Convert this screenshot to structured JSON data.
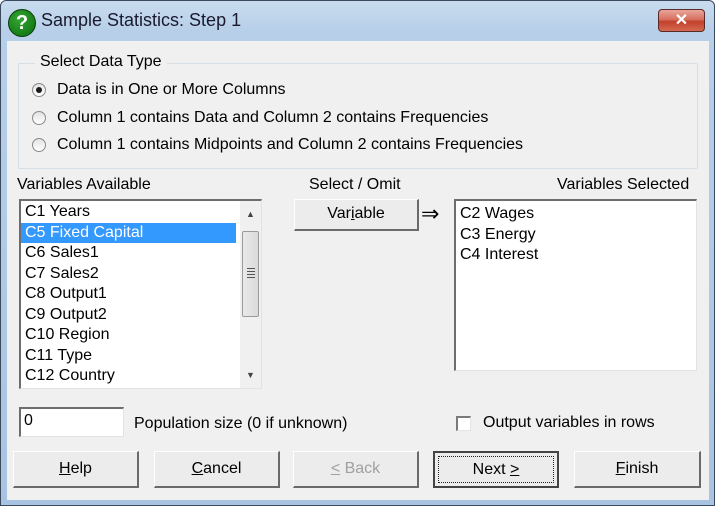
{
  "window": {
    "title": "Sample Statistics: Step 1",
    "app_icon": "question-mark-icon",
    "close_icon": "✕"
  },
  "data_type_group": {
    "title": "Select Data Type",
    "options": [
      {
        "label": "Data is in One or More Columns",
        "checked": true
      },
      {
        "label": "Column 1 contains Data and Column 2 contains Frequencies",
        "checked": false
      },
      {
        "label": "Column 1 contains Midpoints and Column 2 contains Frequencies",
        "checked": false
      }
    ]
  },
  "variables_available": {
    "label": "Variables Available",
    "items": [
      "C1 Years",
      "C5 Fixed Capital",
      "C6 Sales1",
      "C7 Sales2",
      "C8 Output1",
      "C9 Output2",
      "C10 Region",
      "C11 Type",
      "C12 Country"
    ],
    "selected_index": 1
  },
  "select_omit": {
    "label": "Select / Omit",
    "button_label_pre": "Var",
    "button_label_underlined": "i",
    "button_label_post": "able",
    "arrow": "⇒"
  },
  "variables_selected": {
    "label": "Variables Selected",
    "items": [
      "C2 Wages",
      "C3 Energy",
      "C4 Interest"
    ]
  },
  "population": {
    "value": "0",
    "label": "Population size (0 if unknown)"
  },
  "output_rows": {
    "label": "Output variables in rows",
    "checked": false
  },
  "buttons": {
    "help": {
      "u": "H",
      "rest": "elp"
    },
    "cancel": {
      "u": "C",
      "rest": "ancel"
    },
    "back": {
      "u": "<",
      "rest": " Back"
    },
    "next": {
      "pre": "Next ",
      "u": ">"
    },
    "finish": {
      "u": "F",
      "rest": "inish"
    }
  }
}
